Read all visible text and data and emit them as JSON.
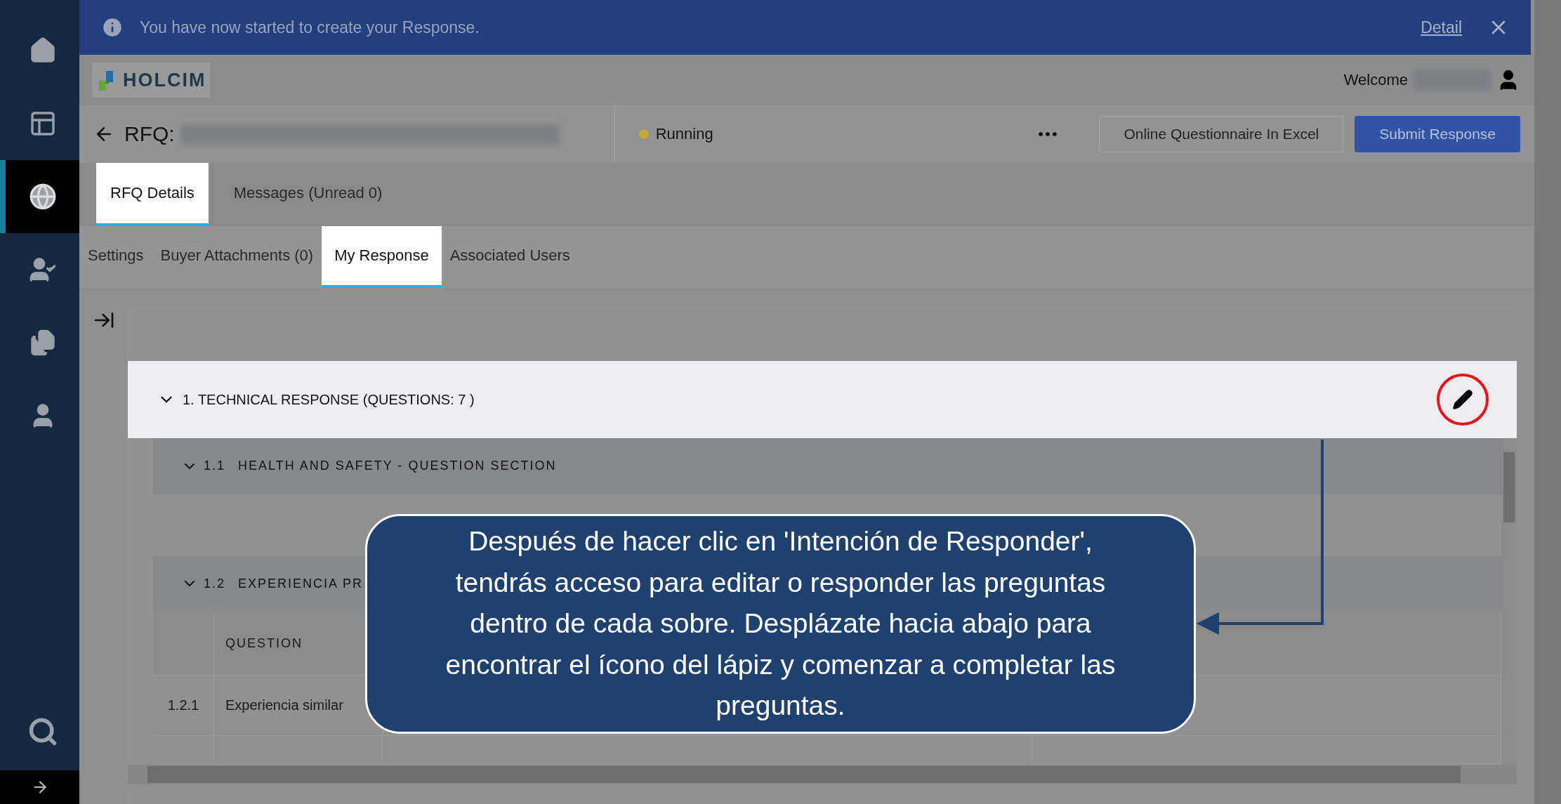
{
  "sidebar": {
    "items": [
      {
        "kind": "home",
        "selected": false
      },
      {
        "kind": "layout",
        "selected": false
      },
      {
        "kind": "globe",
        "selected": true
      },
      {
        "kind": "user-check",
        "selected": false
      },
      {
        "kind": "files",
        "selected": false
      },
      {
        "kind": "user",
        "selected": false
      }
    ],
    "footer": [
      {
        "kind": "search"
      },
      {
        "kind": "expand"
      }
    ]
  },
  "banner": {
    "message": "You have now started to create your Response.",
    "link": "Detail"
  },
  "brand": {
    "name": "HOLCIM"
  },
  "user": {
    "greeting": "Welcome"
  },
  "header": {
    "title_prefix": "RFQ:",
    "status": "Running",
    "buttons": [
      {
        "label": "Online Questionnaire In Excel",
        "kind": "secondary"
      },
      {
        "label": "Submit Response",
        "kind": "primary"
      }
    ]
  },
  "tabs": [
    {
      "label": "RFQ Details",
      "selected": true
    },
    {
      "label": "Messages (Unread 0)",
      "selected": false
    }
  ],
  "subtabs": [
    {
      "label": "Settings",
      "selected": false
    },
    {
      "label": "Buyer Attachments (0)",
      "selected": false
    },
    {
      "label": "My Response",
      "selected": true
    },
    {
      "label": "Associated Users",
      "selected": false
    }
  ],
  "section": {
    "title": "1. TECHNICAL RESPONSE (QUESTIONS: 7 )",
    "expanded": true,
    "subsections": [
      {
        "number": "1.1",
        "title": "HEALTH AND SAFETY - QUESTION SECTION",
        "expanded": true
      },
      {
        "number": "1.2",
        "title": "EXPERIENCIA PR",
        "expanded": true,
        "table": {
          "columns": [
            "QUESTION"
          ],
          "rows": [
            {
              "number": "1.2.1",
              "question": "Experiencia similar"
            }
          ]
        }
      }
    ]
  },
  "callout": {
    "text": "Después de hacer clic en 'Intención de Responder', tendrás acceso para editar o responder las preguntas dentro de cada sobre. Desplázate hacia abajo para encontrar el ícono del lápiz y comenzar a completar las preguntas."
  }
}
